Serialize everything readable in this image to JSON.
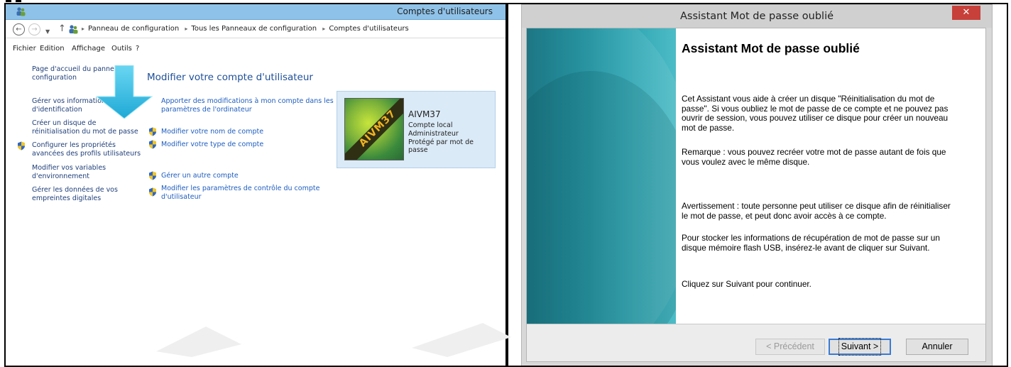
{
  "control_panel": {
    "window_title": "Comptes d'utilisateurs",
    "address": {
      "back_icon": "back-arrow-icon",
      "forward_icon": "forward-arrow-icon",
      "breadcrumbs": [
        "Panneau de configuration",
        "Tous les Panneaux de configuration",
        "Comptes d'utilisateurs"
      ]
    },
    "menu": [
      "Fichier",
      "Edition",
      "Affichage",
      "Outils",
      "?"
    ],
    "sidebar": {
      "home": [
        "Page d'accueil du panneau de",
        "configuration"
      ],
      "links": [
        [
          "Gérer vos informations",
          "d'identification"
        ],
        [
          "Créer un disque de",
          "réinitialisation du mot de passe"
        ],
        [
          "Configurer les propriétés",
          "avancées des profils utilisateurs"
        ],
        [
          "Modifier vos variables",
          "d'environnement"
        ],
        [
          "Gérer les données de vos",
          "empreintes digitales"
        ]
      ]
    },
    "main": {
      "title": "Modifier votre compte d'utilisateur",
      "link_settings": [
        "Apporter des modifications à mon compte dans les",
        "paramètres de l'ordinateur"
      ],
      "link_rename": "Modifier votre nom de compte",
      "link_type": "Modifier votre type de compte",
      "link_other": "Gérer un autre compte",
      "link_uac": [
        "Modifier les paramètres de contrôle du compte",
        "d'utilisateur"
      ]
    },
    "account": {
      "name": "AIVM37",
      "type": "Compte local",
      "role": "Administrateur",
      "status": "Protégé par mot de passe",
      "avatar_text": "AIVM37"
    }
  },
  "wizard": {
    "window_title": "Assistant Mot de passe oublié",
    "close_label": "✕",
    "heading": "Assistant Mot de passe oublié",
    "para1": "Cet Assistant vous aide à créer un disque \"Réinitialisation du mot de passe\". Si vous oubliez le mot de passe de ce compte et ne pouvez pas ouvrir de session, vous pouvez utiliser ce disque pour créer un nouveau mot de passe.",
    "para2": "Remarque : vous pouvez recréer votre mot de passe autant de fois que vous voulez avec le même disque.",
    "para3": "Avertissement : toute personne peut utiliser ce disque afin de réinitialiser le mot de passe, et peut donc avoir accès à ce compte.",
    "para4": "Pour stocker les informations de récupération de mot de passe sur un disque mémoire flash USB, insérez-le avant de cliquer sur Suivant.",
    "para5": "Cliquez sur Suivant pour continuer.",
    "buttons": {
      "back": "< Précédent",
      "next": "Suivant >",
      "cancel": "Annuler"
    }
  },
  "colors": {
    "cp_titlebar": "#8fc2e8",
    "link_blue": "#1e5dbf",
    "wizard_sidebar": "#148795",
    "close_red": "#c7403a",
    "arrow_cyan": "#3fc3e6"
  }
}
